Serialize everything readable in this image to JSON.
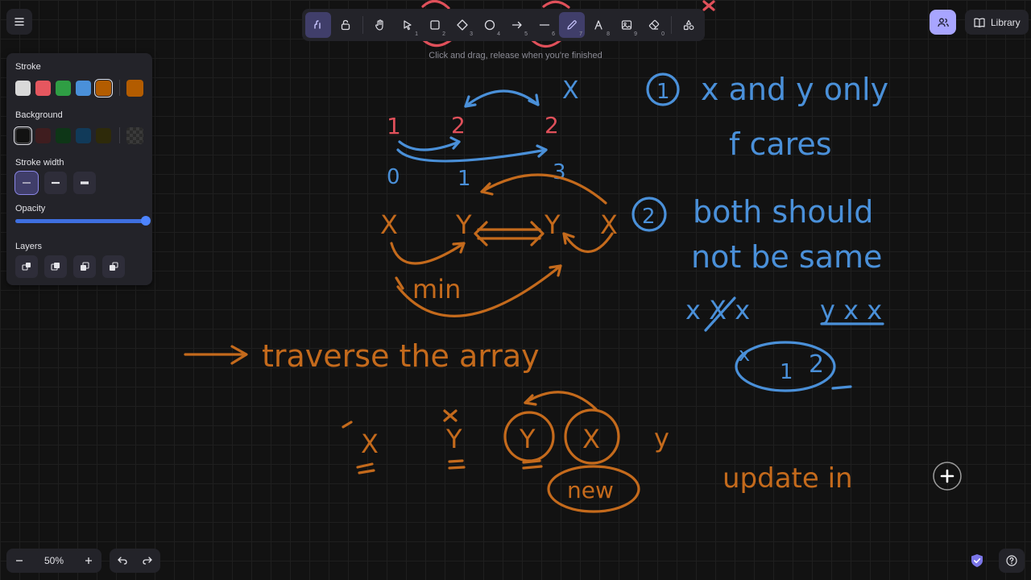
{
  "hint_text": "Click and drag, release when you're finished",
  "library_label": "Library",
  "zoom": {
    "level": "50%"
  },
  "toolbar": {
    "tools": [
      {
        "name": "hand-tool-icon",
        "key": "1"
      },
      {
        "name": "selection-tool-icon",
        "key": "1"
      },
      {
        "name": "rectangle-tool-icon",
        "key": "2"
      },
      {
        "name": "diamond-tool-icon",
        "key": "3"
      },
      {
        "name": "ellipse-tool-icon",
        "key": "4"
      },
      {
        "name": "arrow-tool-icon",
        "key": "5"
      },
      {
        "name": "line-tool-icon",
        "key": "6"
      },
      {
        "name": "draw-tool-icon",
        "key": "7"
      },
      {
        "name": "text-tool-icon",
        "key": "8"
      },
      {
        "name": "image-tool-icon",
        "key": "9"
      },
      {
        "name": "eraser-tool-icon",
        "key": "0"
      }
    ]
  },
  "properties": {
    "stroke_label": "Stroke",
    "background_label": "Background",
    "stroke_width_label": "Stroke width",
    "opacity_label": "Opacity",
    "layers_label": "Layers",
    "stroke_colors": [
      "#d9d9d9",
      "#e5575f",
      "#2f9e44",
      "#4a90d9",
      "#b35c00"
    ],
    "stroke_current": "#b35c00",
    "background_colors": [
      "#121212",
      "#3f1d1f",
      "#0e3617",
      "#113a59",
      "#2e2a0a"
    ],
    "opacity": 100
  },
  "colors": {
    "ink_blue": "#4a90d9",
    "ink_orange": "#c46a1c",
    "ink_red": "#e0505a",
    "accent": "#a8a5ff"
  },
  "sketch": {
    "top_numbers": [
      "1",
      "2",
      "2"
    ],
    "index_numbers": [
      "0",
      "1",
      "3"
    ],
    "x_mark": "X",
    "cycle_labels": [
      "X",
      "Y",
      "Y",
      "X"
    ],
    "min_label": "min",
    "arrow_text": "traverse the array",
    "bottom_labels": [
      "X",
      "Y",
      "Y",
      "X",
      "y"
    ],
    "new_label": "new",
    "update_text": "update in",
    "note1_number": "1",
    "note1_line1": "x and y only",
    "note1_line2": "f cares",
    "note2_number": "2",
    "note2_line1": "both should",
    "note2_line2": "not be same",
    "xx_example": "x X x",
    "yy_example": "y x x",
    "circle_values": [
      "x",
      "1",
      "2"
    ]
  }
}
